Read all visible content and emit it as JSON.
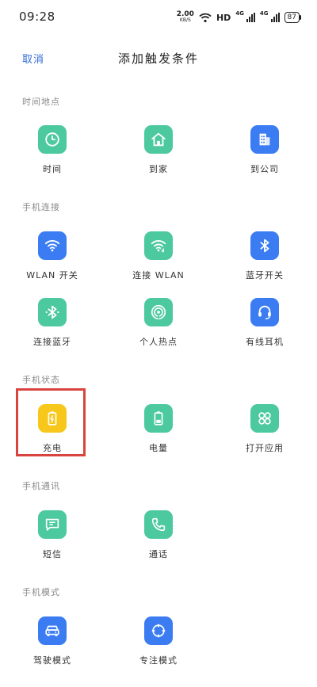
{
  "status_bar": {
    "time": "09:28",
    "speed_value": "2.00",
    "speed_unit": "KB/S",
    "hd": "HD",
    "net1": "4G",
    "net2": "4G",
    "battery": "87"
  },
  "header": {
    "cancel_label": "取消",
    "title": "添加触发条件"
  },
  "sections": {
    "time_place": "时间地点",
    "phone_connect": "手机连接",
    "phone_status": "手机状态",
    "phone_comm": "手机通讯",
    "phone_mode": "手机模式"
  },
  "items": {
    "time": "时间",
    "home": "到家",
    "company": "到公司",
    "wlan_switch": "WLAN 开关",
    "connect_wlan": "连接 WLAN",
    "bt_switch": "蓝牙开关",
    "connect_bt": "连接蓝牙",
    "hotspot": "个人热点",
    "wired_headset": "有线耳机",
    "charging": "充电",
    "battery_level": "电量",
    "open_app": "打开应用",
    "sms": "短信",
    "call": "通话",
    "driving_mode": "驾驶模式",
    "focus_mode": "专注模式"
  },
  "colors": {
    "teal": "#4dc9a0",
    "blue": "#3b7cf2",
    "yellow": "#f7c81b",
    "accent": "#2f6bd8",
    "highlight": "#d9443f"
  }
}
